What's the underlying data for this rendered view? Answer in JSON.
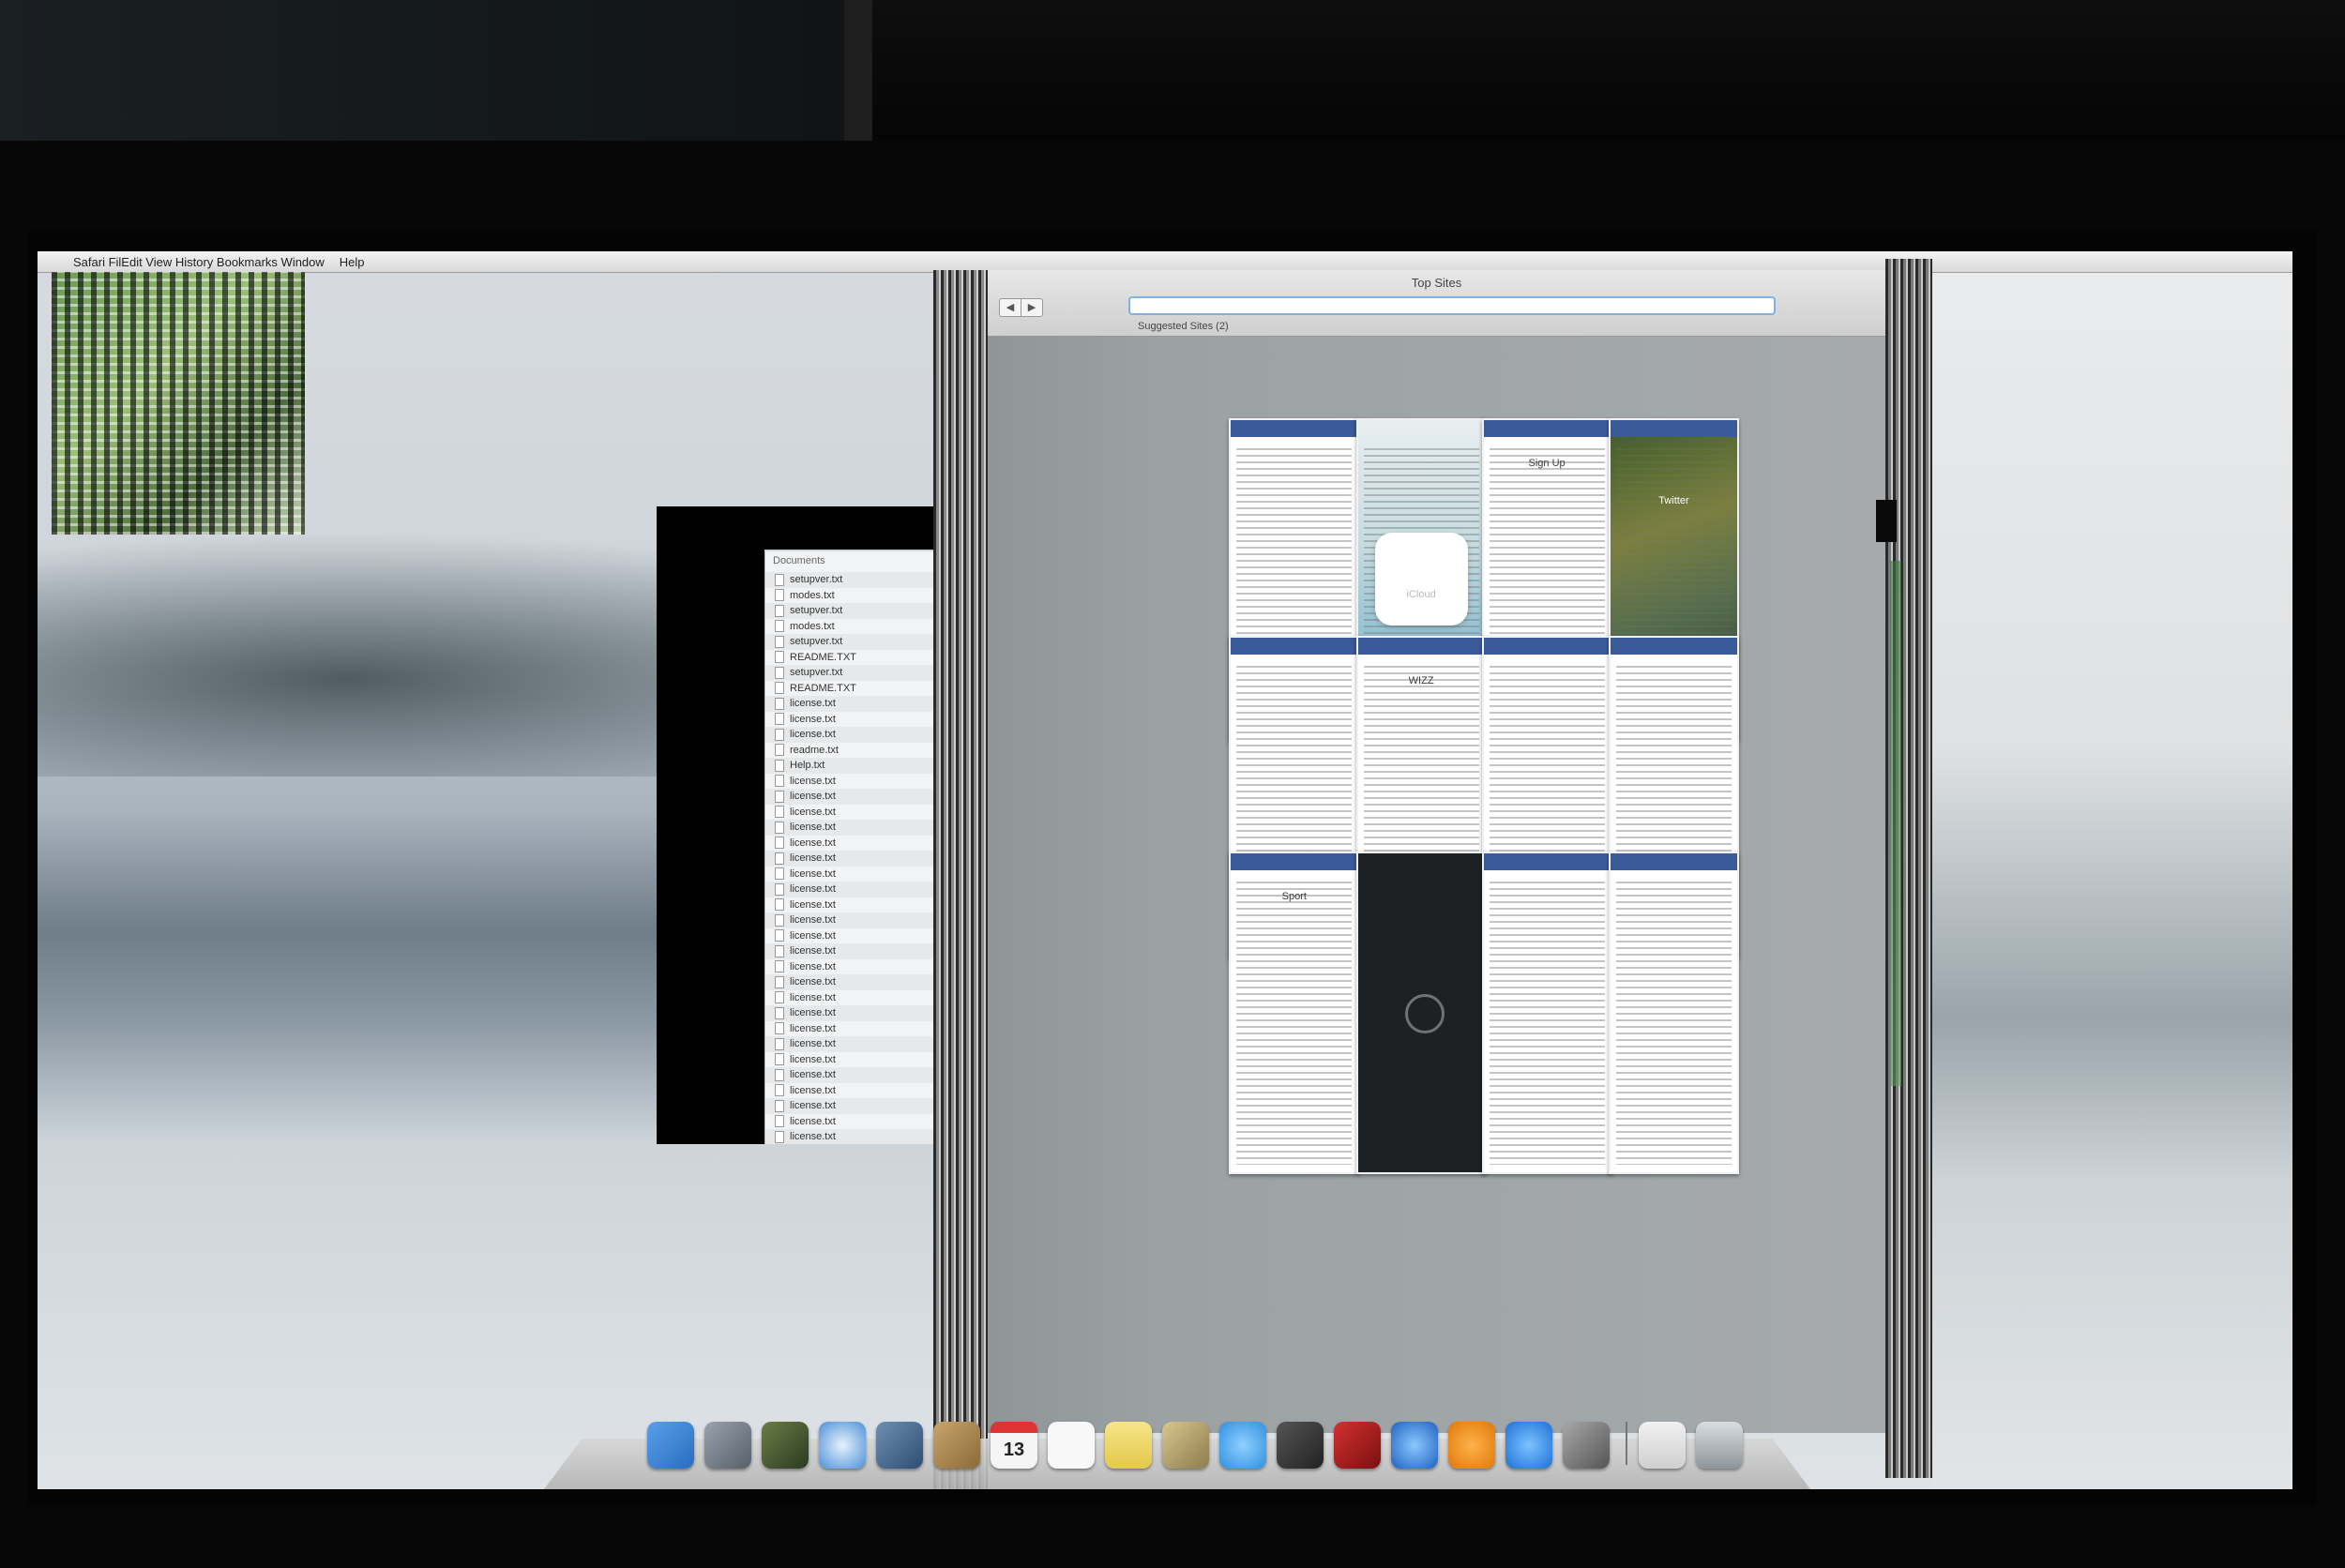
{
  "menubar": {
    "items": [
      "Safari",
      "File",
      "Edit",
      "View",
      "History",
      "Bookmarks",
      "Window",
      "Help"
    ],
    "garbled_label": "Safari FilEdit View History Bookmarks Window"
  },
  "documents": {
    "title": "Documents",
    "files": [
      "setupver.txt",
      "modes.txt",
      "setupver.txt",
      "modes.txt",
      "setupver.txt",
      "README.TXT",
      "setupver.txt",
      "README.TXT",
      "license.txt",
      "license.txt",
      "license.txt",
      "readme.txt",
      "Help.txt",
      "license.txt",
      "license.txt",
      "license.txt",
      "license.txt",
      "license.txt",
      "license.txt",
      "license.txt",
      "license.txt",
      "license.txt",
      "license.txt",
      "license.txt",
      "license.txt",
      "license.txt",
      "license.txt",
      "license.txt",
      "license.txt",
      "license.txt",
      "license.txt",
      "license.txt",
      "license.txt",
      "license.txt",
      "license.txt",
      "license.txt",
      "license.txt"
    ]
  },
  "safari": {
    "title": "Top Sites",
    "address": "",
    "back": "◀",
    "forward": "▶",
    "suggested": "Suggested Sites (2)",
    "tiles": [
      {
        "name": "apple",
        "kind": "page"
      },
      {
        "name": "icloud",
        "kind": "icloud",
        "text": "iCloud"
      },
      {
        "name": "facebook",
        "kind": "page",
        "text": "Sign Up"
      },
      {
        "name": "twitter",
        "kind": "photo",
        "text": "Twitter"
      },
      {
        "name": "wikipedia",
        "kind": "page"
      },
      {
        "name": "wizzair",
        "kind": "page",
        "text": "WIZZ"
      },
      {
        "name": "news",
        "kind": "page"
      },
      {
        "name": "shop",
        "kind": "page"
      },
      {
        "name": "bbc",
        "kind": "page",
        "text": "Sport"
      },
      {
        "name": "dark-site",
        "kind": "dark"
      },
      {
        "name": "sports-table",
        "kind": "page"
      },
      {
        "name": "forum",
        "kind": "page"
      }
    ]
  },
  "dock": {
    "calendar_date": "13",
    "icons": [
      "finder",
      "launchpad",
      "mission-control",
      "safari",
      "iphoto",
      "contacts",
      "calendar",
      "reminders",
      "notes",
      "preview",
      "messages",
      "facetime",
      "photo-booth",
      "itunes",
      "ibooks",
      "app-store",
      "system-preferences",
      "separator",
      "documents-stack",
      "trash"
    ]
  },
  "colors": {
    "accent": "#2f6fd8",
    "address_focus": "#7fb0e6",
    "desktop_mist": "#cfd5db"
  }
}
